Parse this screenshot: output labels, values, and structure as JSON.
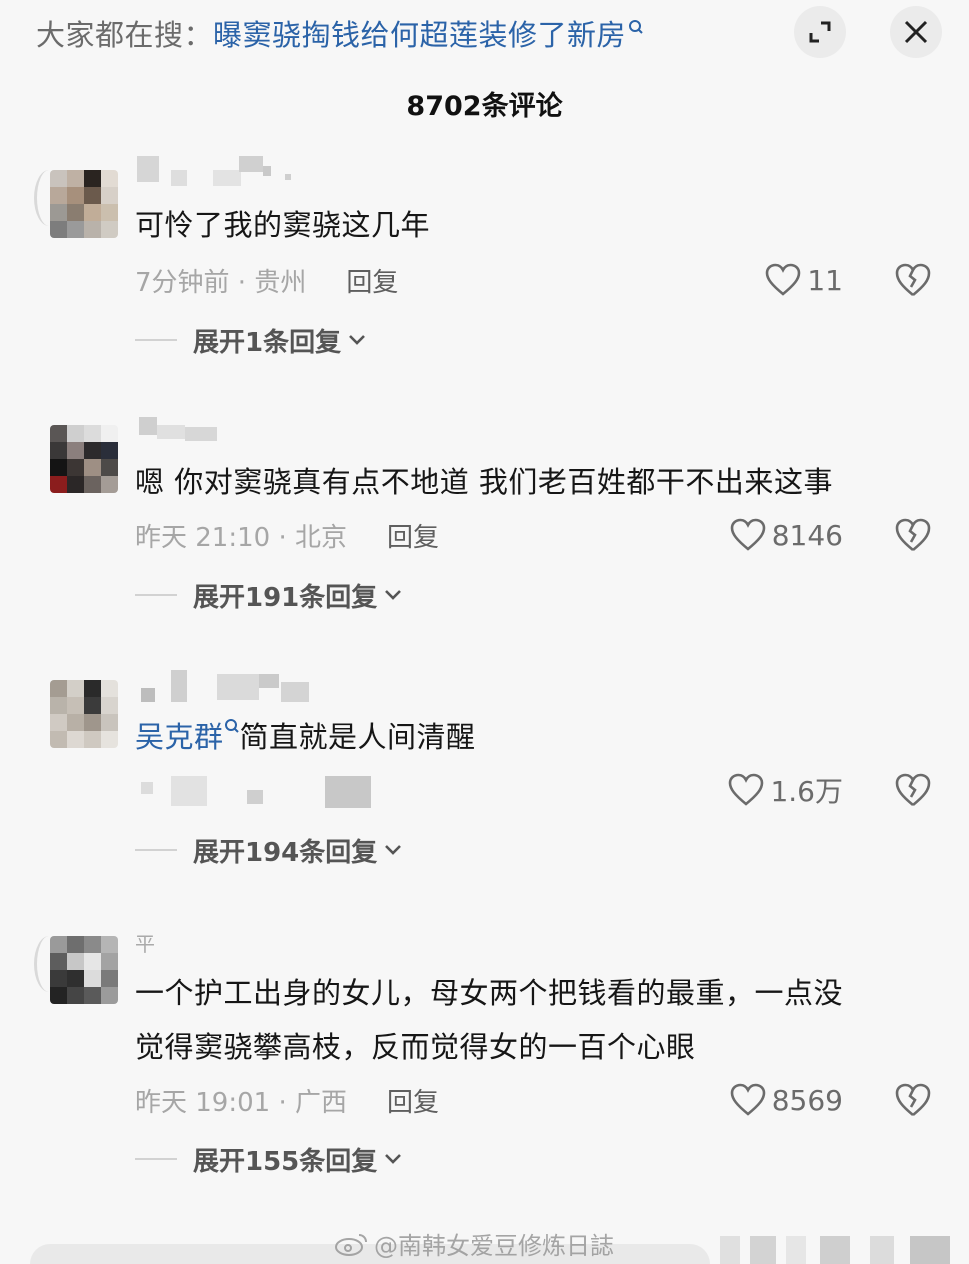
{
  "header": {
    "search_prefix": "大家都在搜：",
    "search_topic": "曝窦骁掏钱给何超莲装修了新房",
    "expand_icon": "expand-icon",
    "close_icon": "close-icon"
  },
  "comment_count": "8702条评论",
  "colors": {
    "link": "#2b63a8",
    "meta": "#a6a6a6",
    "text": "#161616",
    "background": "#f7f7f7"
  },
  "comments": [
    {
      "text": "可怜了我的窦骁这几年",
      "time_location": "7分钟前 · 贵州",
      "reply_label": "回复",
      "likes": "11",
      "expand_label": "展开1条回复"
    },
    {
      "text": "嗯 你对窦骁真有点不地道 我们老百姓都干不出来这事",
      "time_location": "昨天 21:10 · 北京",
      "reply_label": "回复",
      "likes": "8146",
      "expand_label": "展开191条回复"
    },
    {
      "mention": "吴克群",
      "text": "简直就是人间清醒",
      "likes": "1.6万",
      "expand_label": "展开194条回复"
    },
    {
      "username": "平",
      "text_line1": "一个护工出身的女儿，母女两个把钱看的最重，一点没",
      "text_line2": "觉得窦骁攀高枝，反而觉得女的一百个心眼",
      "time_location": "昨天 19:01 · 广西",
      "reply_label": "回复",
      "likes": "8569",
      "expand_label": "展开155条回复"
    }
  ],
  "watermark": "@南韩女爱豆修炼日誌"
}
